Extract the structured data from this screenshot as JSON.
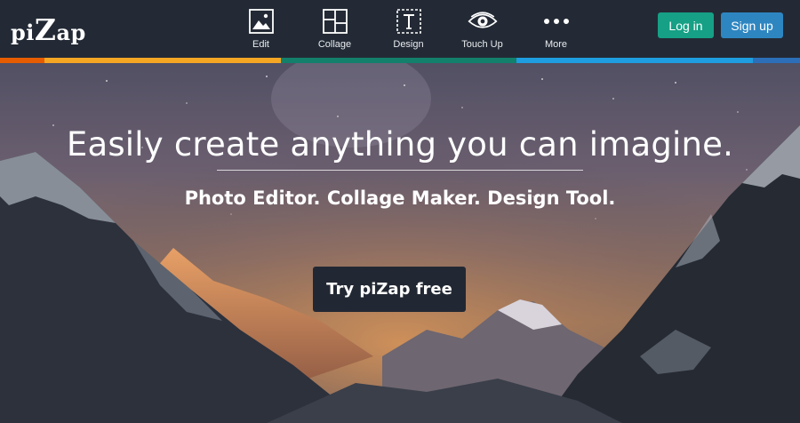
{
  "brand": {
    "logo_pre": "pi",
    "logo_z": "Z",
    "logo_post": "ap"
  },
  "nav": {
    "items": [
      {
        "label": "Edit",
        "icon": "image-icon"
      },
      {
        "label": "Collage",
        "icon": "collage-grid-icon"
      },
      {
        "label": "Design",
        "icon": "text-frame-icon"
      },
      {
        "label": "Touch Up",
        "icon": "eye-icon"
      },
      {
        "label": "More",
        "icon": "more-dots-icon"
      }
    ]
  },
  "auth": {
    "login_label": "Log in",
    "signup_label": "Sign up"
  },
  "colors": {
    "topbar": "#232a35",
    "login": "#16a085",
    "signup": "#2e86c1",
    "cta": "#222833",
    "stripe": [
      "#e65c00",
      "#f5a623",
      "#12806b",
      "#1e9ee0",
      "#2c6fb8"
    ]
  },
  "hero": {
    "headline": "Easily create anything you can imagine.",
    "subline": "Photo Editor. Collage Maker. Design Tool.",
    "cta_label": "Try piZap free"
  }
}
